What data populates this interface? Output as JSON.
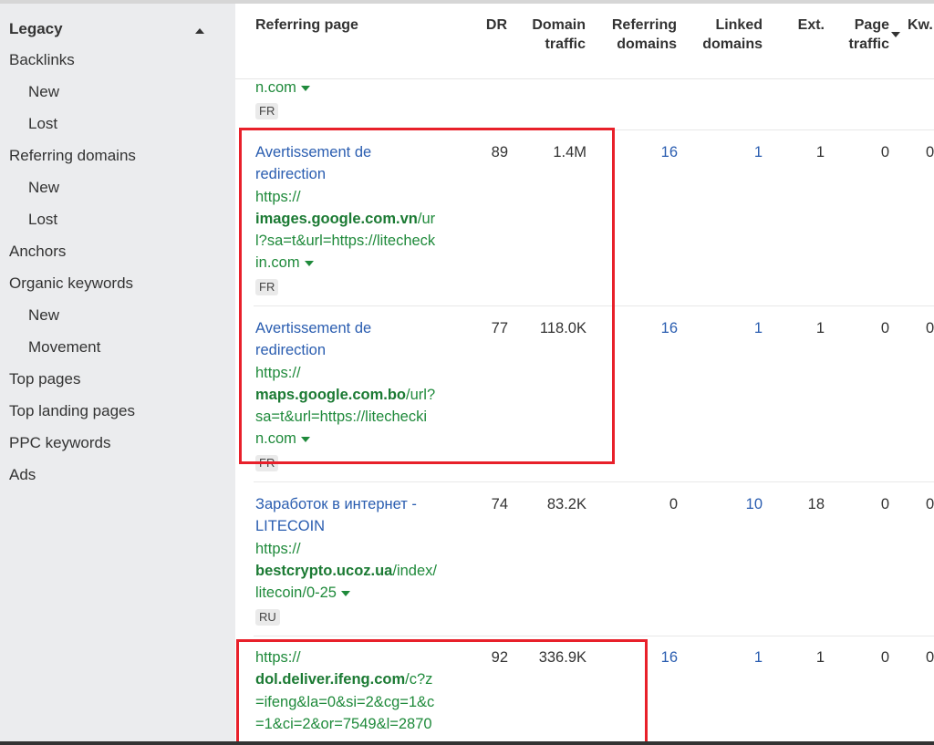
{
  "sidebar": {
    "section_title": "Legacy",
    "items": [
      {
        "label": "Backlinks",
        "level": 1
      },
      {
        "label": "New",
        "level": 2
      },
      {
        "label": "Lost",
        "level": 2
      },
      {
        "label": "Referring domains",
        "level": 1
      },
      {
        "label": "New",
        "level": 2
      },
      {
        "label": "Lost",
        "level": 2
      },
      {
        "label": "Anchors",
        "level": 1
      },
      {
        "label": "Organic keywords",
        "level": 1
      },
      {
        "label": "New",
        "level": 2
      },
      {
        "label": "Movement",
        "level": 2
      },
      {
        "label": "Top pages",
        "level": 1
      },
      {
        "label": "Top landing pages",
        "level": 1
      },
      {
        "label": "PPC keywords",
        "level": 1
      },
      {
        "label": "Ads",
        "level": 1
      }
    ]
  },
  "table": {
    "columns": {
      "referring_page": "Referring page",
      "dr": "DR",
      "domain_traffic_1": "Domain",
      "domain_traffic_2": "traffic",
      "referring_domains_1": "Referring",
      "referring_domains_2": "domains",
      "linked_domains_1": "Linked",
      "linked_domains_2": "domains",
      "ext": "Ext.",
      "page_traffic_1": "Page",
      "page_traffic_2": "traffic",
      "kw": "Kw."
    },
    "partial_row": {
      "url_tail": "n.com",
      "lang": "FR"
    },
    "rows": [
      {
        "title_1": "Avertissement de",
        "title_2": "redirection",
        "url_1": "https://",
        "url_domain": "images.google.com.vn",
        "url_2": "/ur",
        "url_3": "l?sa=t&url=https://litecheck",
        "url_4": "in.com",
        "lang": "FR",
        "dr": "89",
        "domain_traffic": "1.4M",
        "referring_domains": "16",
        "linked_domains": "1",
        "ext": "1",
        "page_traffic": "0",
        "kw": "0"
      },
      {
        "title_1": "Avertissement de",
        "title_2": "redirection",
        "url_1": "https://",
        "url_domain": "maps.google.com.bo",
        "url_2": "/url?",
        "url_3": "sa=t&url=https://litechecki",
        "url_4": "n.com",
        "lang": "FR",
        "dr": "77",
        "domain_traffic": "118.0K",
        "referring_domains": "16",
        "linked_domains": "1",
        "ext": "1",
        "page_traffic": "0",
        "kw": "0"
      },
      {
        "title_1": "Заработок в интернет -",
        "title_2": "LITECOIN",
        "url_1": "https://",
        "url_domain": "bestcrypto.ucoz.ua",
        "url_2": "/index/",
        "url_3": "litecoin/0-25",
        "lang": "RU",
        "dr": "74",
        "domain_traffic": "83.2K",
        "referring_domains": "0",
        "linked_domains": "10",
        "ext": "18",
        "page_traffic": "0",
        "kw": "0"
      },
      {
        "url_1": "https://",
        "url_domain": "dol.deliver.ifeng.com",
        "url_2": "/c?z",
        "url_3": "=ifeng&la=0&si=2&cg=1&c",
        "url_4": "=1&ci=2&or=7549&l=2870",
        "dr": "92",
        "domain_traffic": "336.9K",
        "referring_domains": "16",
        "linked_domains": "1",
        "ext": "1",
        "page_traffic": "0",
        "kw": "0"
      }
    ]
  },
  "colors": {
    "link_blue": "#2a5db0",
    "url_green": "#1f8a3b",
    "highlight_red": "#e8202a",
    "sidebar_bg": "#ebecee"
  }
}
